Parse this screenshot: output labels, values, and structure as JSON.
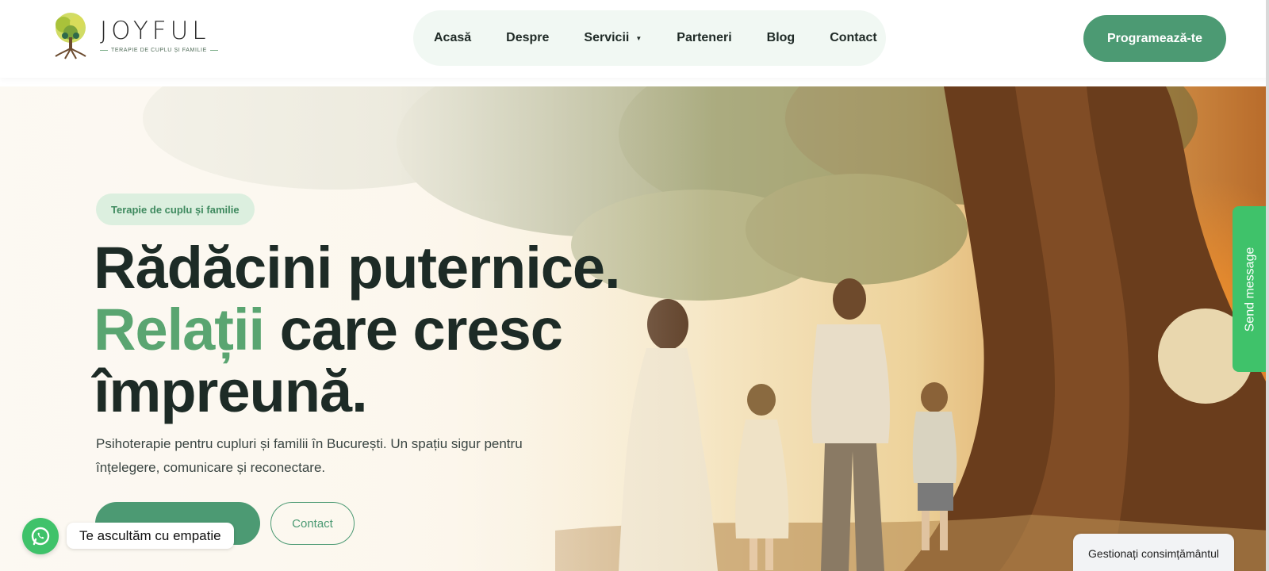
{
  "brand": {
    "name": "JOYFUL",
    "tagline": "TERAPIE DE CUPLU ȘI FAMILIE"
  },
  "nav": {
    "items": [
      {
        "label": "Acasă"
      },
      {
        "label": "Despre"
      },
      {
        "label": "Servicii",
        "has_dropdown": true
      },
      {
        "label": "Parteneri"
      },
      {
        "label": "Blog"
      },
      {
        "label": "Contact"
      }
    ],
    "cta_label": "Programează-te"
  },
  "hero": {
    "badge": "Terapie de cuplu și familie",
    "headline_line1": "Rădăcini puternice.",
    "headline_accent": "Relații",
    "headline_line2_rest": " care cresc",
    "headline_line3": "împreună.",
    "lead": "Psihoterapie pentru cupluri și familii în București. Un spațiu sigur pentru înțelegere, comunicare și reconectare.",
    "primary_button_label": "",
    "secondary_button_label": "Contact"
  },
  "widgets": {
    "whatsapp_tooltip": "Te ascultăm cu empatie",
    "send_message_label": "Send message",
    "consent_label": "Gestionați consimțământul"
  },
  "colors": {
    "brand_green": "#4c9a73",
    "accent_green": "#5aa571",
    "whatsapp_green": "#3fc26a",
    "nav_bg": "#f1f8f3",
    "badge_bg": "#dcefdf",
    "heading_dark": "#1d2b26"
  },
  "icons": {
    "logo": "tree-family-logo-icon",
    "whatsapp": "whatsapp-icon",
    "dropdown": "caret-down-icon"
  }
}
